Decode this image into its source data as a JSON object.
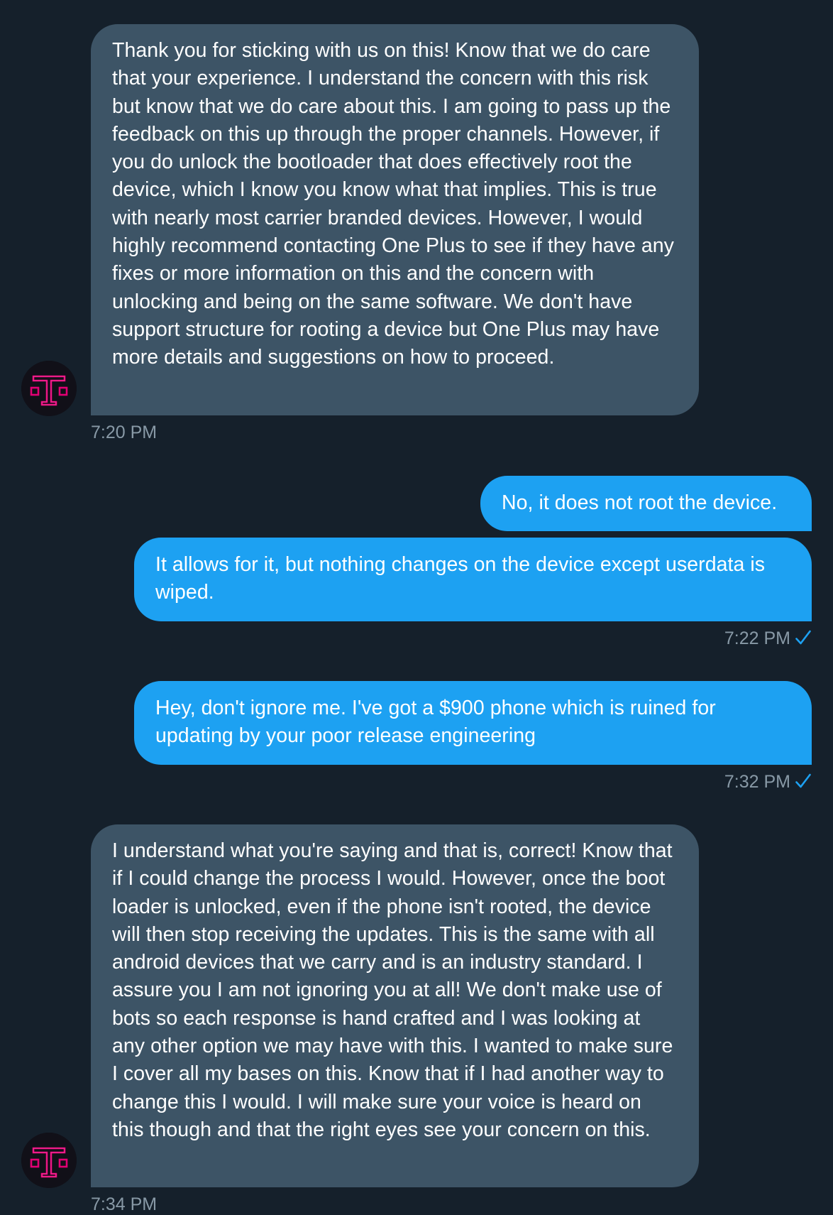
{
  "colors": {
    "background": "#15202b",
    "incoming_bubble": "#3d5466",
    "outgoing_bubble": "#1da1f2",
    "timestamp": "#8899a6",
    "read_check": "#1da1f2",
    "brand_magenta": "#e20074"
  },
  "messages": [
    {
      "direction": "incoming",
      "text": "Thank you for sticking with us on this! Know that we do care that your experience. I understand the concern with this risk but know that we do care about this. I am going to pass up the feedback on this up through the proper channels. However, if you do unlock the bootloader that does effectively root the device, which I know you know what that implies. This is true with nearly most carrier branded devices. However, I would highly recommend contacting One Plus to see if they have any fixes or more information on this and the concern with unlocking and being on the same software. We don't have support structure for rooting a device but One Plus may have more details and suggestions on how to proceed.",
      "time": "7:20 PM",
      "avatar_icon": "t-mobile-logo-icon"
    },
    {
      "direction": "outgoing",
      "text": "No, it does not root the device."
    },
    {
      "direction": "outgoing",
      "text": "It allows for it, but nothing changes on the device except userdata is wiped.",
      "time": "7:22 PM",
      "status_icon": "read-check-icon"
    },
    {
      "direction": "outgoing",
      "text": "Hey, don't ignore me. I've got a $900 phone which is ruined for updating by your poor release engineering",
      "time": "7:32 PM",
      "status_icon": "read-check-icon"
    },
    {
      "direction": "incoming",
      "text": "I understand what you're saying and that is, correct! Know that if I could change the process I would. However, once the boot loader is unlocked, even if the phone isn't rooted, the device will then stop receiving the updates. This is the same with all android devices that we carry and is an industry standard. I assure you I am not ignoring you at all! We don't make use of bots so each response is hand crafted and I was looking at any other option we may have with this. I wanted to make sure I cover all my bases on this. Know that if I had another way to change this I would. I will make sure your voice is heard on this though and that the right eyes see your concern on this.",
      "time": "7:34 PM",
      "avatar_icon": "t-mobile-logo-icon"
    }
  ]
}
